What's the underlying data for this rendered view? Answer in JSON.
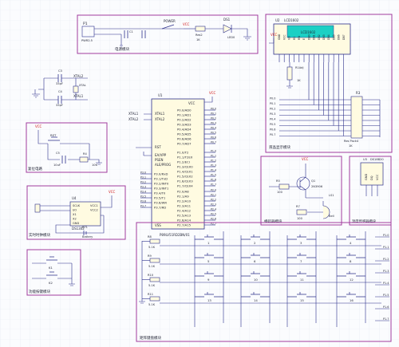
{
  "colors": {
    "grid": "#e6e9f2",
    "box": "#a03b9d",
    "wire": "#2c2f8a",
    "text": "#1f2233",
    "chip": "#fffbe1",
    "lcd_screen": "#1cd0c4",
    "red": "#d01515",
    "green": "#3a8a3a"
  },
  "blocks": {
    "power": {
      "title": "电源模块",
      "p1": "P1",
      "pwr_ic": "PWR2.5",
      "power_label": "POWER",
      "ds1": "DS1",
      "vcc": "VCC",
      "c_label": "C1",
      "res": "Res2",
      "res_val": "1K",
      "led": "LED0"
    },
    "crystal": {
      "title": "晶振模块",
      "xtal1": "XTAL1",
      "xtal2": "XTAL2",
      "c3": "C3",
      "c4": "C4",
      "cap_val": "33pF",
      "xtal": "XTAL"
    },
    "reset": {
      "title": "复位电路",
      "vcc": "VCC",
      "rst": "RST",
      "c": "C5",
      "cap_val": "10uF",
      "r": "R4",
      "r_val": "10K"
    },
    "rtc": {
      "title": "实时时钟模块",
      "chip": "DS1302",
      "u": "U4",
      "pins_left": [
        "SCLK",
        "I/O",
        "X1",
        "X2",
        "GND"
      ],
      "pins_right": [
        "VCC1",
        "VCC2"
      ],
      "battery": "Battery",
      "bt": "BT1",
      "y": "Y2",
      "vcc": "VCC"
    },
    "switch": {
      "title": "功能按键模块",
      "k1": "K1",
      "k2": "K2"
    },
    "mcu": {
      "chip": "P89LV51RD2BN/01",
      "u": "U1",
      "xtal1": "XTAL1",
      "xtal2": "XTAL2",
      "rst": "RST",
      "ea": "EA/VPP",
      "psen": "PSEN",
      "ale": "ALE/PROG",
      "vcc": "VCC",
      "vss": "VSS",
      "p0": [
        "P0.0/AD0",
        "P0.1/AD1",
        "P0.2/AD2",
        "P0.3/AD3",
        "P0.4/AD4",
        "P0.5/AD5",
        "P0.6/AD6",
        "P0.7/AD7"
      ],
      "p1": [
        "P1.0/T2",
        "P1.1/T2EX",
        "P1.2/ECI",
        "P1.3/CEX0",
        "P1.4/CEX1",
        "P1.5/CEX2",
        "P1.6/CEX3",
        "P1.7/CEX4"
      ],
      "p3": [
        "P3.0/RxD",
        "P3.1/TxD",
        "P3.2/INT0",
        "P3.3/INT1",
        "P3.4/T0",
        "P3.5/T1",
        "P3.6/WR",
        "P3.7/RD"
      ],
      "p2": [
        "P2.0/A8",
        "P2.1/A9",
        "P2.2/A10",
        "P2.3/A11",
        "P2.4/A12",
        "P2.5/A13",
        "P2.6/A14",
        "P2.7/A15"
      ],
      "p0_nets": [
        "P0.0",
        "P0.1",
        "P0.2",
        "P0.3",
        "P0.4",
        "P0.5",
        "P0.6",
        "P0.7"
      ],
      "p1_nets": [
        "P1.0",
        "P1.1",
        "P1.2",
        "P1.3",
        "P1.4",
        "P1.5",
        "P1.6",
        "P1.7"
      ],
      "p3_nets": [
        "P3.0",
        "P3.1",
        "P3.2",
        "P3.3",
        "P3.4",
        "P3.5",
        "P3.6",
        "P3.7"
      ],
      "p2_nets": [
        "P2.0",
        "P2.1",
        "P2.2",
        "P2.3",
        "P2.4",
        "P2.5",
        "P2.6",
        "P2.7"
      ]
    },
    "lcd": {
      "title": "液晶显示模块",
      "name": "LCD1602",
      "u": "U2",
      "vcc": "VCC",
      "pins": [
        "GND",
        "VCC",
        "VO",
        "RS",
        "RW",
        "E",
        "DB0",
        "DB1",
        "DB2",
        "DB3",
        "DB4",
        "DB5",
        "DB6",
        "DB7"
      ],
      "rp": "R3",
      "rp_name": "Res Pack4",
      "rp_val": "1K",
      "adj": "R1Adj",
      "adj_val": "1K",
      "nets": [
        "P0.0",
        "P0.1",
        "P0.2",
        "P0.3",
        "P0.4",
        "P0.5",
        "P0.6",
        "P0.7"
      ]
    },
    "buzzer": {
      "title": "蜂鸣器模块",
      "vcc": "VCC",
      "q": "Q1",
      "q_type": "2N3906",
      "r": "R5",
      "r_val": "100",
      "r2": "R7",
      "r2_val": "100",
      "ls": "LS1",
      "ls_name": "Bell"
    },
    "temp": {
      "title": "温度传感器模块",
      "u": "U3",
      "chip": "DS18B20",
      "pins": [
        "GND",
        "DQ",
        "VCC"
      ]
    },
    "keys": {
      "title": "矩阵键盘模块",
      "resistors": [
        "R8",
        "R9",
        "R10",
        "R11"
      ],
      "res_val": "5.1K",
      "key_numbers": [
        "1",
        "2",
        "3",
        "4",
        "5",
        "6",
        "7",
        "8",
        "9",
        "10",
        "11",
        "12",
        "13",
        "14",
        "15",
        "16"
      ],
      "nets_right": [
        "P1.0",
        "P1.1",
        "P1.2",
        "P1.3",
        "P1.4",
        "P1.5",
        "P1.6",
        "P1.7"
      ]
    }
  }
}
